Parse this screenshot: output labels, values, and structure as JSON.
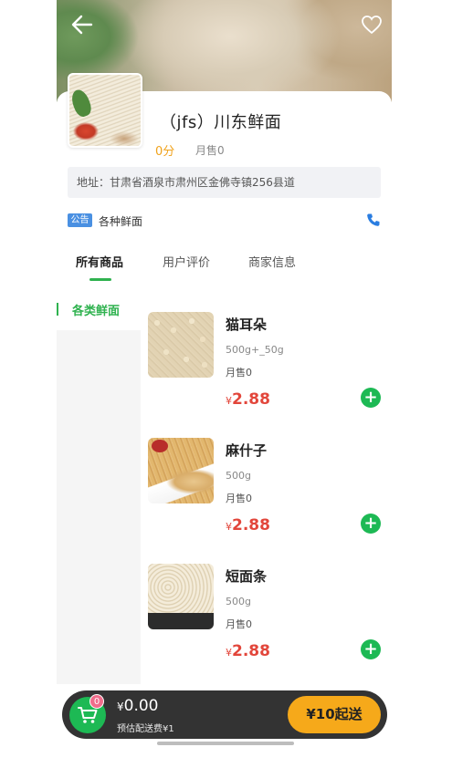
{
  "header": {
    "back_icon": "arrow-left-icon",
    "favorite_icon": "heart-icon"
  },
  "shop": {
    "name": "（jfs）川东鲜面",
    "score": "0分",
    "monthly_sales": "月售0",
    "address": "地址：甘肃省酒泉市肃州区金佛寺镇256县道",
    "notice_badge": "公告",
    "notice_text": "各种鲜面",
    "phone_icon": "phone-icon"
  },
  "tabs": [
    {
      "label": "所有商品",
      "active": true
    },
    {
      "label": "用户评价",
      "active": false
    },
    {
      "label": "商家信息",
      "active": false
    }
  ],
  "categories": [
    {
      "label": "各类鲜面",
      "active": true
    }
  ],
  "products": [
    {
      "name": "猫耳朵",
      "spec": "500g+_50g",
      "sold": "月售0",
      "currency": "¥",
      "price": "2.88",
      "add_label": "+"
    },
    {
      "name": "麻什子",
      "spec": "500g",
      "sold": "月售0",
      "currency": "¥",
      "price": "2.88",
      "add_label": "+"
    },
    {
      "name": "短面条",
      "spec": "500g",
      "sold": "月售0",
      "currency": "¥",
      "price": "2.88",
      "add_label": "+"
    }
  ],
  "cart": {
    "count": "0",
    "currency": "¥",
    "total": "0.00",
    "delivery_fee": "预估配送费¥1",
    "min_order": "¥10起送"
  },
  "colors": {
    "accent": "#1db954",
    "price": "#e2463b",
    "min_order": "#f6a91a",
    "score": "#f0a21b"
  }
}
